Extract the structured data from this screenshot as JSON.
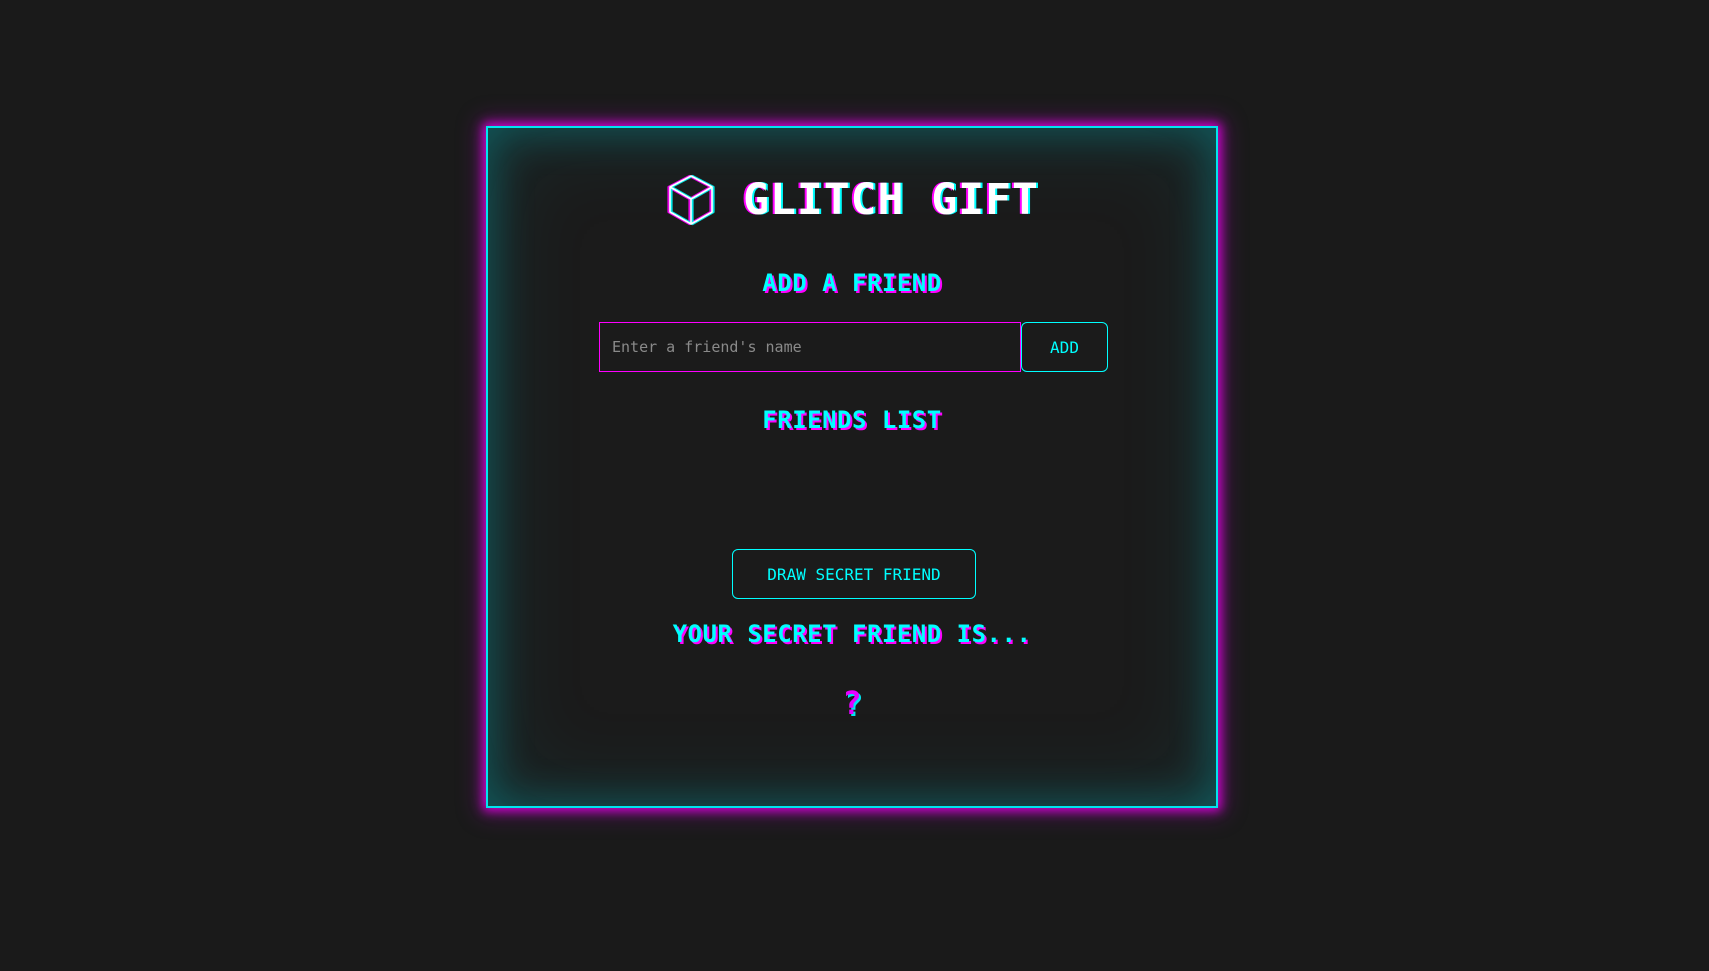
{
  "app": {
    "title": "GLITCH GIFT",
    "logo_icon": "cube-icon"
  },
  "add_section": {
    "heading": "ADD A FRIEND",
    "input_placeholder": "Enter a friend's name",
    "input_value": "",
    "add_button_label": "ADD"
  },
  "friends_section": {
    "heading": "FRIENDS LIST",
    "friends": []
  },
  "draw": {
    "button_label": "DRAW SECRET FRIEND"
  },
  "result": {
    "heading": "YOUR SECRET FRIEND IS...",
    "value": "?"
  },
  "colors": {
    "background": "#1a1a1a",
    "accent_cyan": "#00ffff",
    "accent_magenta": "#ff00ff"
  }
}
